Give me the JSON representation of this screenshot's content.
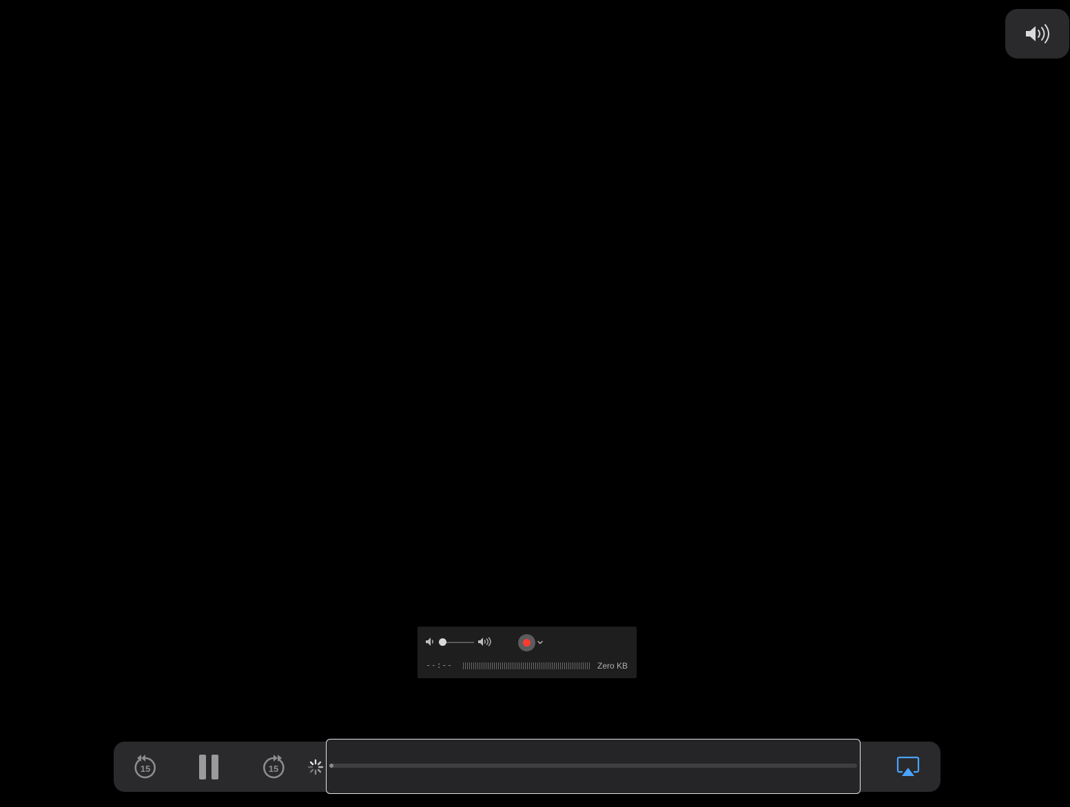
{
  "top_volume": {
    "icon": "speaker-wave-icon"
  },
  "recording_panel": {
    "volume_low_icon": "speaker-low-icon",
    "volume_high_icon": "speaker-high-icon",
    "volume_level": 0.0,
    "record_icon": "record-icon",
    "record_color": "#ff3b30",
    "options_icon": "chevron-down-icon",
    "elapsed_time": "--:--",
    "file_size": "Zero KB"
  },
  "controller": {
    "skip_back": {
      "icon": "skip-back-15-icon",
      "label": "15"
    },
    "pause": {
      "icon": "pause-icon"
    },
    "skip_forward": {
      "icon": "skip-forward-15-icon",
      "label": "15"
    },
    "loading_icon": "loading-spinner-icon",
    "progress": 0.005,
    "airplay": {
      "icon": "airplay-icon",
      "color": "#4aa3ff"
    }
  }
}
